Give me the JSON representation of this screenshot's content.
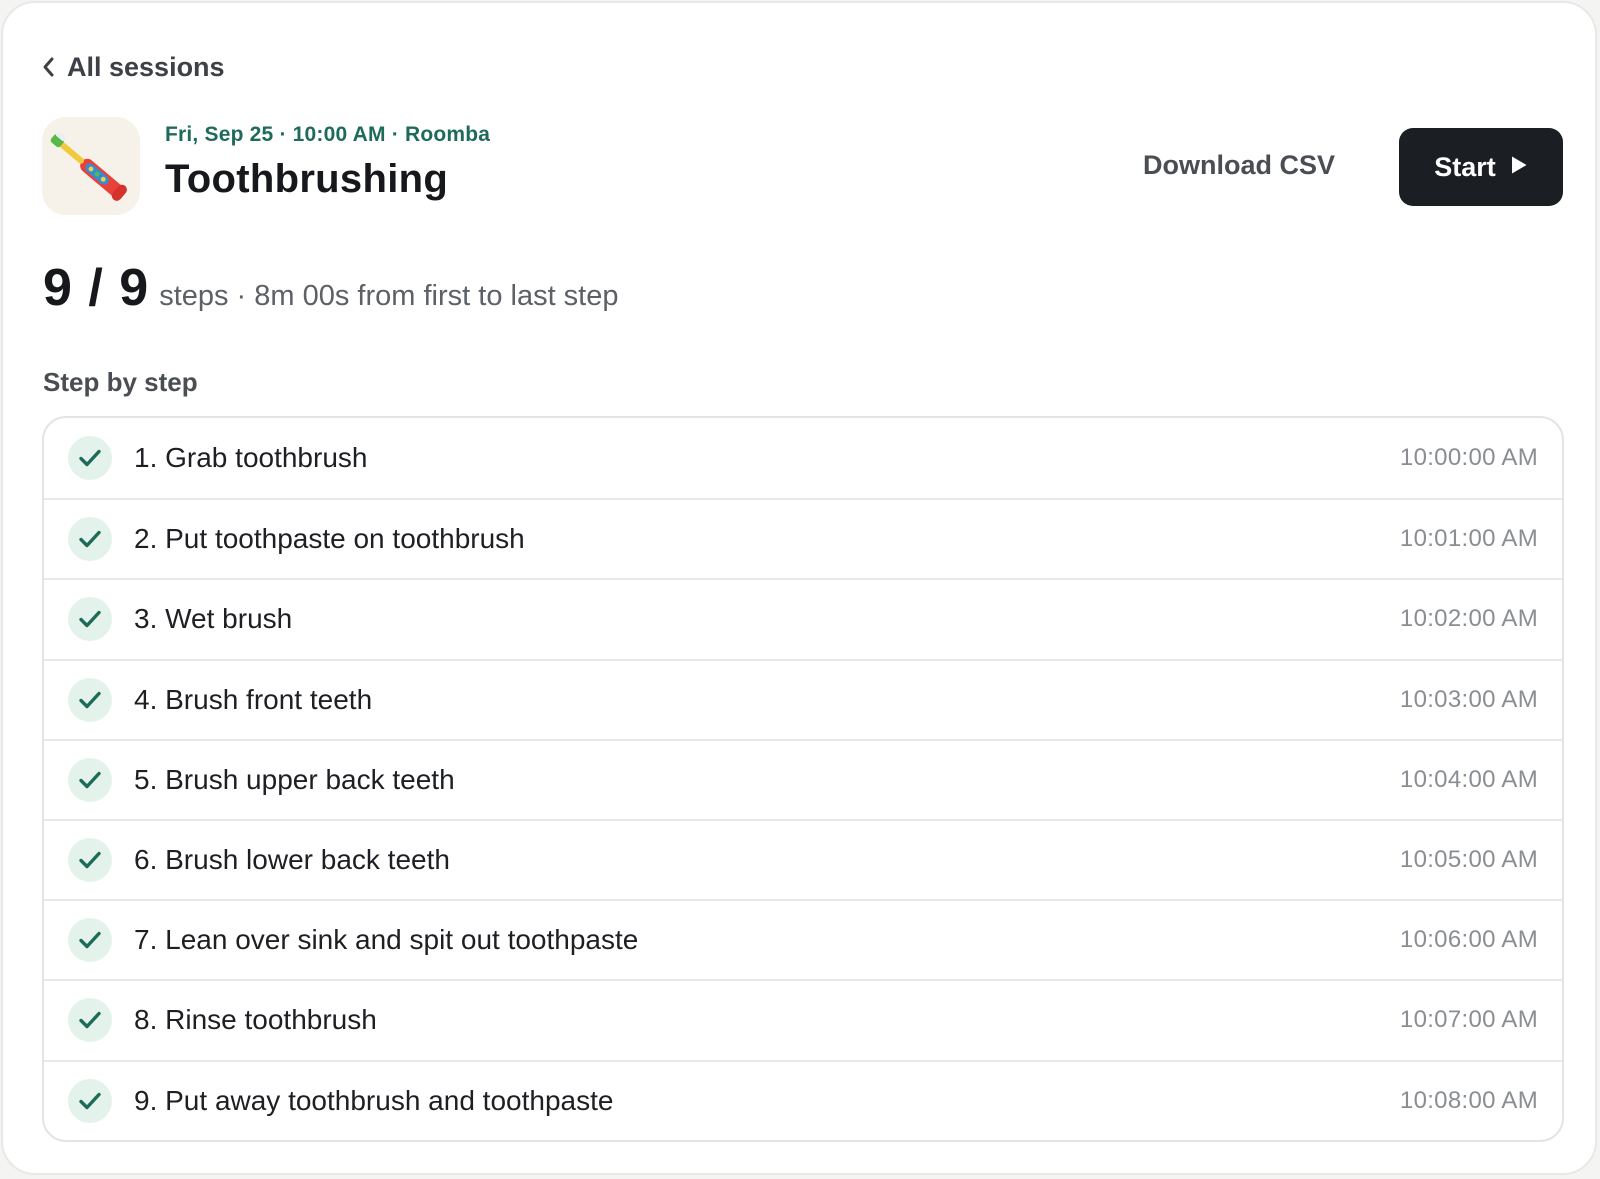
{
  "nav": {
    "back_label": "All sessions",
    "back_icon": "chevron-left-icon"
  },
  "session": {
    "icon": "toothbrush-icon",
    "meta": "Fri, Sep 25 · 10:00 AM · Roomba",
    "title": "Toothbrushing"
  },
  "actions": {
    "download_label": "Download CSV",
    "start_label": "Start",
    "start_icon": "play-icon"
  },
  "summary": {
    "count": "9 / 9",
    "detail": "steps · 8m 00s from first to last step"
  },
  "steps_section": {
    "heading": "Step by step",
    "items": [
      {
        "label": "1. Grab toothbrush",
        "time": "10:00:00 AM"
      },
      {
        "label": "2. Put toothpaste on toothbrush",
        "time": "10:01:00 AM"
      },
      {
        "label": "3. Wet brush",
        "time": "10:02:00 AM"
      },
      {
        "label": "4. Brush front teeth",
        "time": "10:03:00 AM"
      },
      {
        "label": "5. Brush upper back teeth",
        "time": "10:04:00 AM"
      },
      {
        "label": "6. Brush lower back teeth",
        "time": "10:05:00 AM"
      },
      {
        "label": "7. Lean over sink and spit out toothpaste",
        "time": "10:06:00 AM"
      },
      {
        "label": "8. Rinse toothbrush",
        "time": "10:07:00 AM"
      },
      {
        "label": "9. Put away toothbrush and toothpaste",
        "time": "10:08:00 AM"
      }
    ]
  },
  "colors": {
    "accent_green": "#1f6b5b",
    "check_bg": "#e4f2ec",
    "primary_button": "#1b1e22"
  }
}
